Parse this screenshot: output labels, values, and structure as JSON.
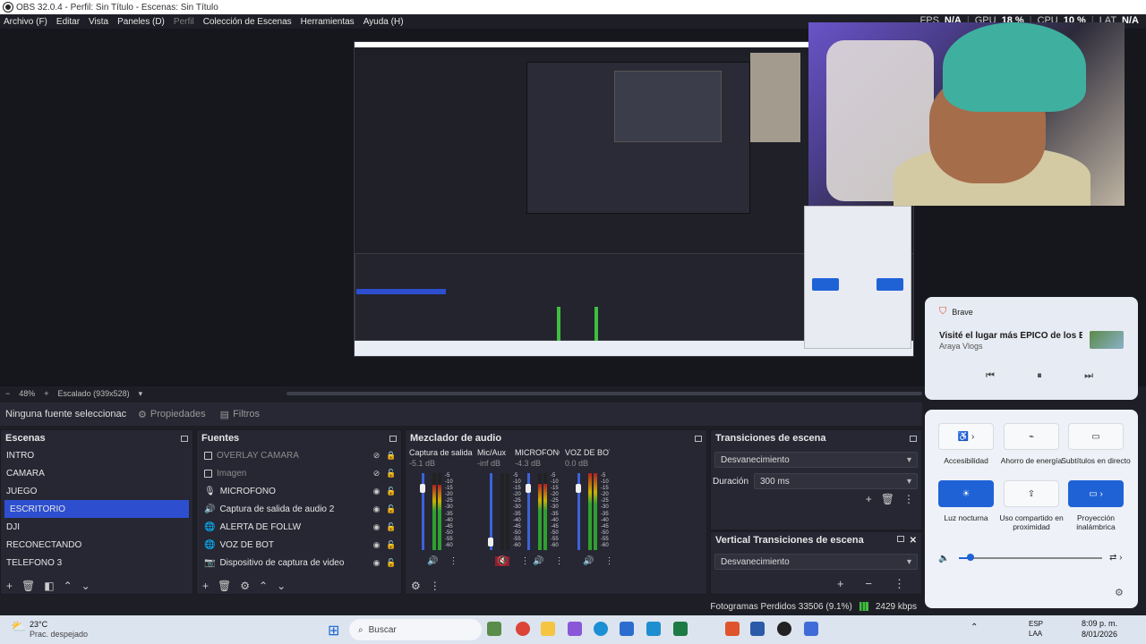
{
  "window": {
    "title": "OBS 32.0.4 - Perfil: Sin Título - Escenas: Sin Título"
  },
  "menu": {
    "items": [
      {
        "label": "Archivo (F)",
        "disabled": false
      },
      {
        "label": "Editar",
        "disabled": false
      },
      {
        "label": "Vista",
        "disabled": false
      },
      {
        "label": "Paneles (D)",
        "disabled": false
      },
      {
        "label": "Perfil",
        "disabled": true
      },
      {
        "label": "Colección de Escenas",
        "disabled": false
      },
      {
        "label": "Herramientas",
        "disabled": false
      },
      {
        "label": "Ayuda (H)",
        "disabled": false
      }
    ]
  },
  "stats": {
    "fps_label": "FPS",
    "fps_value": "N/A",
    "gpu_label": "GPU",
    "gpu_value": "18 %",
    "cpu_label": "CPU",
    "cpu_value": "10 %",
    "lat_label": "LAT",
    "lat_value": "N/A"
  },
  "scale": {
    "zoom": "48%",
    "label": "Escalado (939x528)"
  },
  "context": {
    "no_source": "Ninguna fuente seleccionac",
    "properties": "Propiedades",
    "filters": "Filtros"
  },
  "scenes": {
    "title": "Escenas",
    "items": [
      "INTRO",
      "CAMARA",
      "JUEGO",
      "ESCRITORIO",
      "DJI",
      "RECONECTANDO",
      "TELEFONO 3"
    ],
    "selected": "ESCRITORIO"
  },
  "sources": {
    "title": "Fuentes",
    "items": [
      {
        "name": "OVERLAY CAMARA",
        "icon": "image-icon",
        "hidden": true
      },
      {
        "name": "Imagen",
        "icon": "image-icon",
        "hidden": true
      },
      {
        "name": "MICROFONO",
        "icon": "microphone-icon",
        "hidden": false
      },
      {
        "name": "Captura de salida de audio 2",
        "icon": "speaker-icon",
        "hidden": false
      },
      {
        "name": "ALERTA DE FOLLW",
        "icon": "globe-icon",
        "hidden": false
      },
      {
        "name": "VOZ DE BOT",
        "icon": "globe-icon",
        "hidden": false
      },
      {
        "name": "Dispositivo de captura de video",
        "icon": "camera-icon",
        "hidden": false
      }
    ]
  },
  "mixer": {
    "title": "Mezclador de audio",
    "ticks": [
      "-5",
      "-10",
      "-15",
      "-20",
      "-25",
      "-30",
      "-35",
      "-40",
      "-45",
      "-50",
      "-55",
      "-60"
    ],
    "channels": [
      {
        "name": "Captura de salida c",
        "db": "-5.1 dB",
        "level": 0.85,
        "muted": false
      },
      {
        "name": "Mic/Aux",
        "db": "-inf dB",
        "level": 0.0,
        "muted": true
      },
      {
        "name": "MICROFONO",
        "db": "-4.3 dB",
        "level": 0.86,
        "muted": false
      },
      {
        "name": "VOZ DE BOT",
        "db": "0.0 dB",
        "level": 1.0,
        "muted": false
      }
    ]
  },
  "transitions": {
    "title": "Transiciones de escena",
    "selected": "Desvanecimiento",
    "duration_label": "Duración",
    "duration_value": "300 ms"
  },
  "vertical_transitions": {
    "title": "Vertical Transiciones de escena",
    "selected": "Desvanecimiento"
  },
  "status": {
    "dropped": "Fotogramas Perdidos 33506 (9.1%)",
    "bitrate": "2429 kbps"
  },
  "media": {
    "app": "Brave",
    "title": "Visité el lugar más ÉPICO de los EST...",
    "artist": "Araya Vlogs"
  },
  "quick_settings": {
    "tiles": [
      {
        "label": "Accesibilidad",
        "on": false
      },
      {
        "label": "Ahorro de energía",
        "on": false
      },
      {
        "label": "Subtítulos en directo",
        "on": false
      },
      {
        "label": "Luz nocturna",
        "on": true
      },
      {
        "label": "Uso compartido en proximidad",
        "on": false
      },
      {
        "label": "Proyección inalámbrica",
        "on": true
      }
    ],
    "volume": 0.08
  },
  "taskbar": {
    "weather_temp": "23°C",
    "weather_desc": "Prac. despejado",
    "search": "Buscar",
    "lang1": "ESP",
    "lang2": "LAA",
    "time": "8:09 p. m.",
    "date": "8/01/2026"
  },
  "colors": {
    "accent": "#2d4fcf",
    "panel": "#262733",
    "bg": "#1e1f26"
  }
}
